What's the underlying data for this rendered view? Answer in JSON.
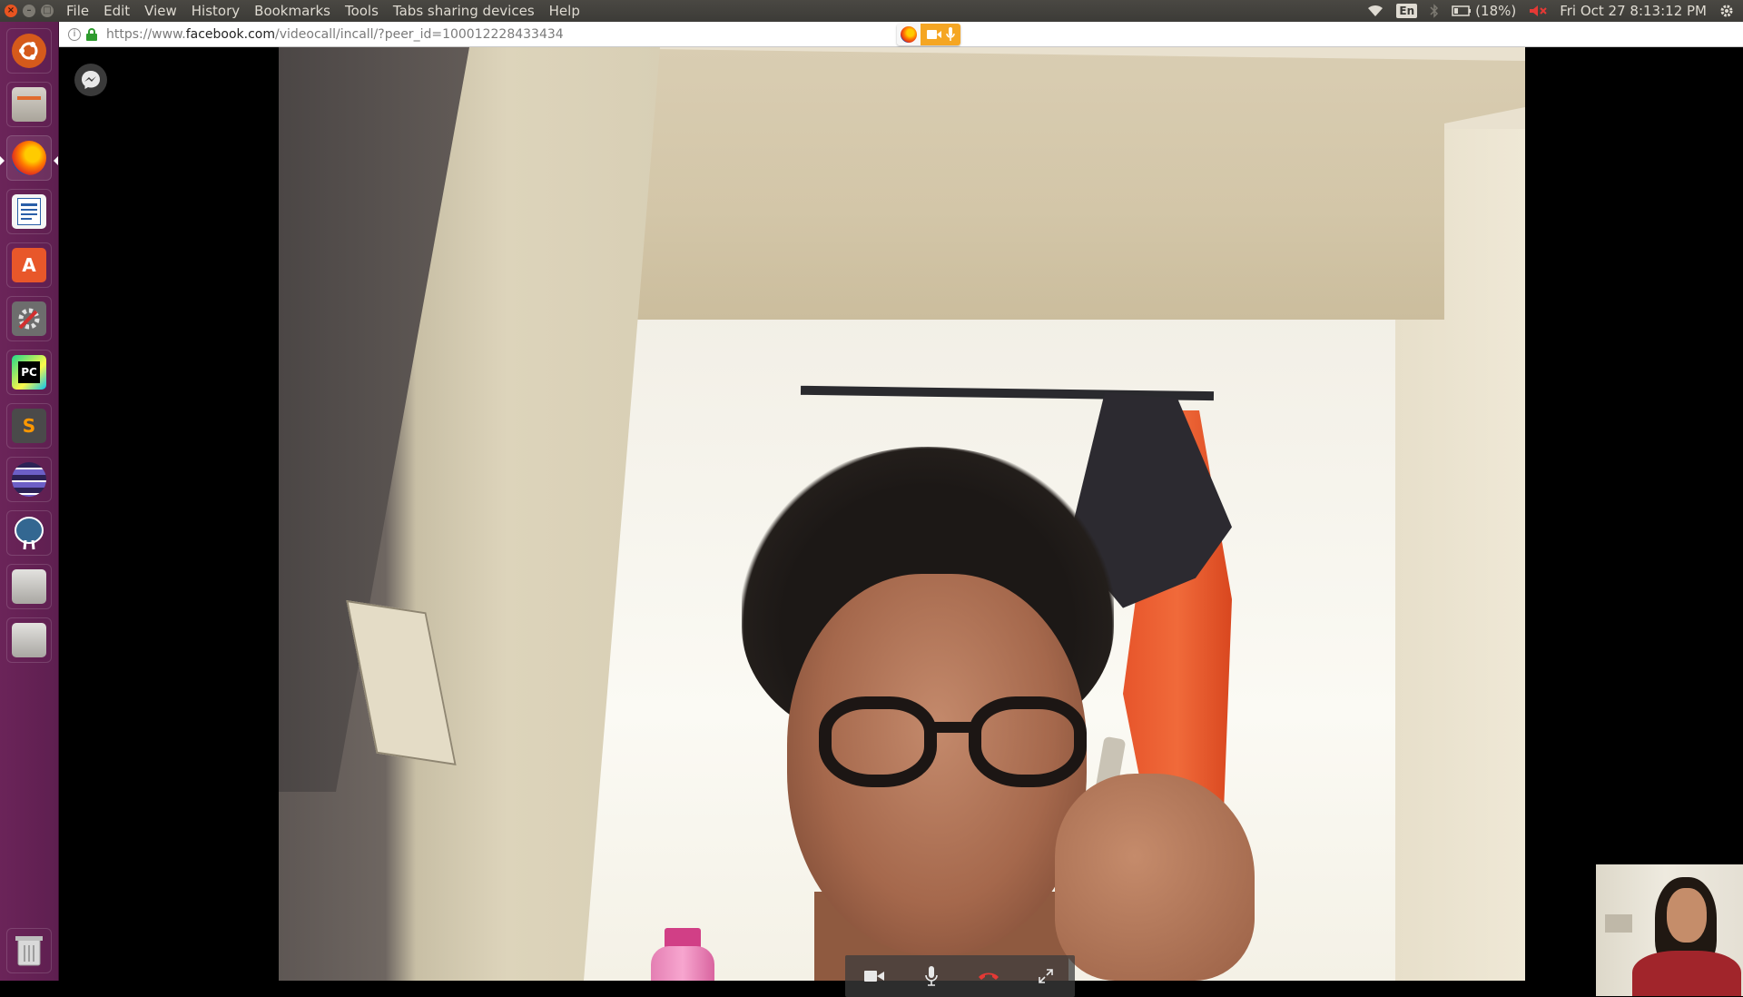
{
  "menubar": {
    "menus": [
      "File",
      "Edit",
      "View",
      "History",
      "Bookmarks",
      "Tools",
      "Tabs sharing devices",
      "Help"
    ],
    "language": "En",
    "battery": "(18%)",
    "clock": "Fri Oct 27  8:13:12 PM"
  },
  "launcher": {
    "items": [
      {
        "name": "ubuntu-dash-icon",
        "color": "#d55a1b"
      },
      {
        "name": "files-icon",
        "color": "#8f8a80"
      },
      {
        "name": "firefox-icon",
        "color": "#e66000"
      },
      {
        "name": "libreoffice-writer-icon",
        "color": "#2a5fa8"
      },
      {
        "name": "software-center-icon",
        "color": "#e8572a"
      },
      {
        "name": "system-settings-icon",
        "color": "#6d6d6d"
      },
      {
        "name": "pycharm-icon",
        "color": "#21d789",
        "label": "PC"
      },
      {
        "name": "sublime-text-icon",
        "color": "#4a4a4a",
        "label": "S"
      },
      {
        "name": "eclipse-icon",
        "color": "#2c2255"
      },
      {
        "name": "pgadmin-icon",
        "color": "#336791"
      },
      {
        "name": "drive-icon-1",
        "color": "#b8b6b2"
      },
      {
        "name": "drive-icon-2",
        "color": "#b8b6b2"
      },
      {
        "name": "trash-icon",
        "color": "#cfcfcf"
      }
    ]
  },
  "urlbar": {
    "prefix": "https://www.",
    "domain": "facebook.com",
    "path": "/videocall/incall/?peer_id=100012228433434"
  },
  "colors": {
    "accent_orange": "#f5a623",
    "hangup_red": "#e53935",
    "launcher_bg": "#5e1f50"
  }
}
